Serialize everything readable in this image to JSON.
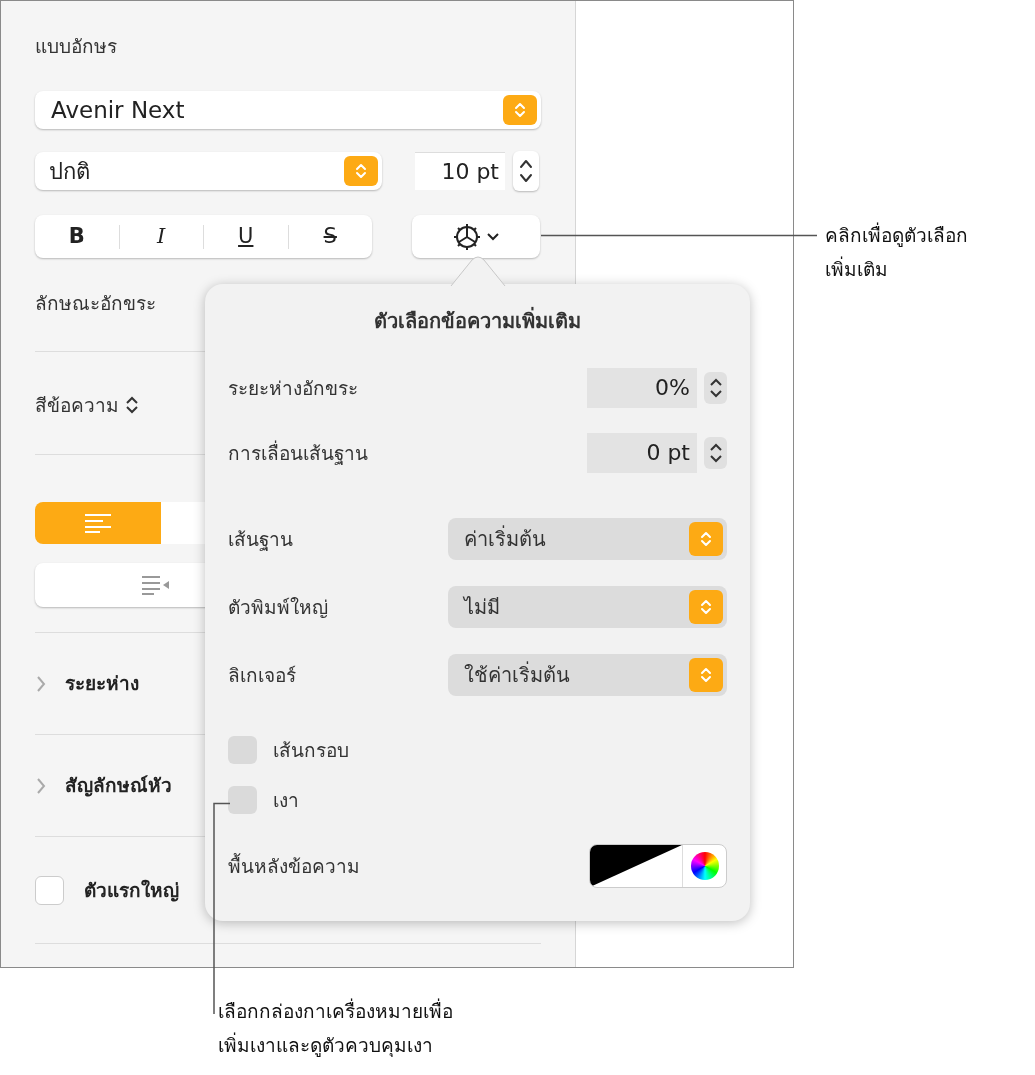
{
  "inspector": {
    "font_heading": "แบบอักษร",
    "font_family": "Avenir Next",
    "font_style": "ปกติ",
    "font_size": "10 pt",
    "style_buttons": [
      {
        "label": "B",
        "kind": "bold"
      },
      {
        "label": "I",
        "kind": "italic"
      },
      {
        "label": "U",
        "kind": "underline"
      },
      {
        "label": "S",
        "kind": "strike"
      }
    ],
    "character_style_label": "ลักษณะอักขระ",
    "text_color_label": "สีข้อความ",
    "alignment": [
      {
        "selected": true
      },
      {
        "selected": false
      }
    ],
    "sections": [
      {
        "label": "ระยะห่าง",
        "expanded": false
      },
      {
        "label": "สัญลักษณ์หัว",
        "expanded": false
      }
    ],
    "drop_cap": {
      "label": "ตัวแรกใหญ่",
      "checked": false
    }
  },
  "popover": {
    "title": "ตัวเลือกข้อความเพิ่มเติม",
    "steppers": [
      {
        "label": "ระยะห่างอักขระ",
        "value": "0%"
      },
      {
        "label": "การเลื่อนเส้นฐาน",
        "value": "0 pt"
      }
    ],
    "menus": [
      {
        "label": "เส้นฐาน",
        "value": "ค่าเริ่มต้น"
      },
      {
        "label": "ตัวพิมพ์ใหญ่",
        "value": "ไม่มี"
      },
      {
        "label": "ลิเกเจอร์",
        "value": "ใช้ค่าเริ่มต้น"
      }
    ],
    "checkboxes": [
      {
        "label": "เส้นกรอบ",
        "checked": false
      },
      {
        "label": "เงา",
        "checked": false
      }
    ],
    "background_label": "พื้นหลังข้อความ"
  },
  "callouts": [
    {
      "text": "คลิกเพื่อดูตัวเลือก\nเพิ่มเติม"
    },
    {
      "text": "เลือกกล่องกาเครื่องหมายเพื่อ\nเพิ่มเงาและดูตัวควบคุมเงา"
    }
  ]
}
